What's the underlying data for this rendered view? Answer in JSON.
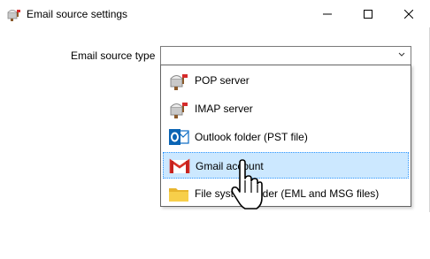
{
  "window": {
    "title": "Email source settings",
    "icon": "mailbox-icon",
    "controls": [
      "minimize-icon",
      "maximize-icon",
      "close-icon"
    ]
  },
  "form": {
    "email_source_type": {
      "label": "Email source type",
      "value": "",
      "dropdown_open": true,
      "options": [
        {
          "label": "POP server",
          "icon": "mailbox-icon"
        },
        {
          "label": "IMAP server",
          "icon": "mailbox-icon"
        },
        {
          "label": "Outlook folder (PST file)",
          "icon": "outlook-icon"
        },
        {
          "label": "Gmail account",
          "icon": "gmail-icon",
          "highlighted": true
        },
        {
          "label": "File system folder (EML and MSG files)",
          "icon": "folder-icon"
        }
      ]
    }
  },
  "cursor": {
    "type": "hand-pointer-icon"
  }
}
